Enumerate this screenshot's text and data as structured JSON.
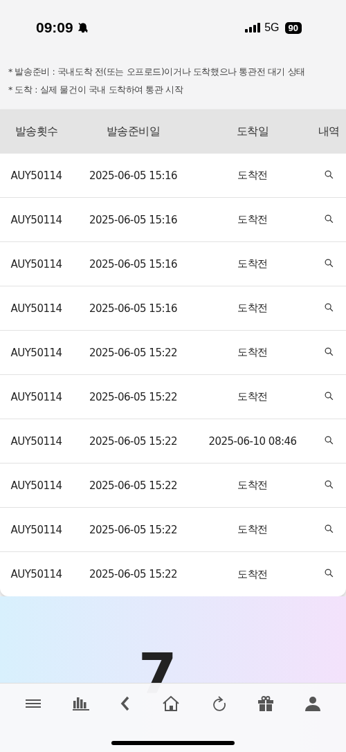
{
  "status_bar": {
    "time": "09:09",
    "network": "5G",
    "battery": "90",
    "silent": true
  },
  "notes": [
    "* 발송준비 : 국내도착 전(또는 오프로드)이거나 도착했으나 통관전 대기 상태",
    "* 도착 : 실제 물건이 국내 도착하여 통관 시작"
  ],
  "table": {
    "columns": [
      "발송횟수",
      "발송준비일",
      "도착일",
      "내역"
    ],
    "rows": [
      {
        "count": "AUY50114",
        "ready_date": "2025-06-05 15:16",
        "arrival": "도착전"
      },
      {
        "count": "AUY50114",
        "ready_date": "2025-06-05 15:16",
        "arrival": "도착전"
      },
      {
        "count": "AUY50114",
        "ready_date": "2025-06-05 15:16",
        "arrival": "도착전"
      },
      {
        "count": "AUY50114",
        "ready_date": "2025-06-05 15:16",
        "arrival": "도착전"
      },
      {
        "count": "AUY50114",
        "ready_date": "2025-06-05 15:22",
        "arrival": "도착전"
      },
      {
        "count": "AUY50114",
        "ready_date": "2025-06-05 15:22",
        "arrival": "도착전"
      },
      {
        "count": "AUY50114",
        "ready_date": "2025-06-05 15:22",
        "arrival": "2025-06-10 08:46"
      },
      {
        "count": "AUY50114",
        "ready_date": "2025-06-05 15:22",
        "arrival": "도착전"
      },
      {
        "count": "AUY50114",
        "ready_date": "2025-06-05 15:22",
        "arrival": "도착전"
      },
      {
        "count": "AUY50114",
        "ready_date": "2025-06-05 15:22",
        "arrival": "도착전"
      }
    ]
  },
  "big_glyph": "7",
  "bottom_nav": [
    {
      "kind": "menu"
    },
    {
      "kind": "chart"
    },
    {
      "kind": "back"
    },
    {
      "kind": "home"
    },
    {
      "kind": "refresh"
    },
    {
      "kind": "gift"
    },
    {
      "kind": "user"
    }
  ]
}
